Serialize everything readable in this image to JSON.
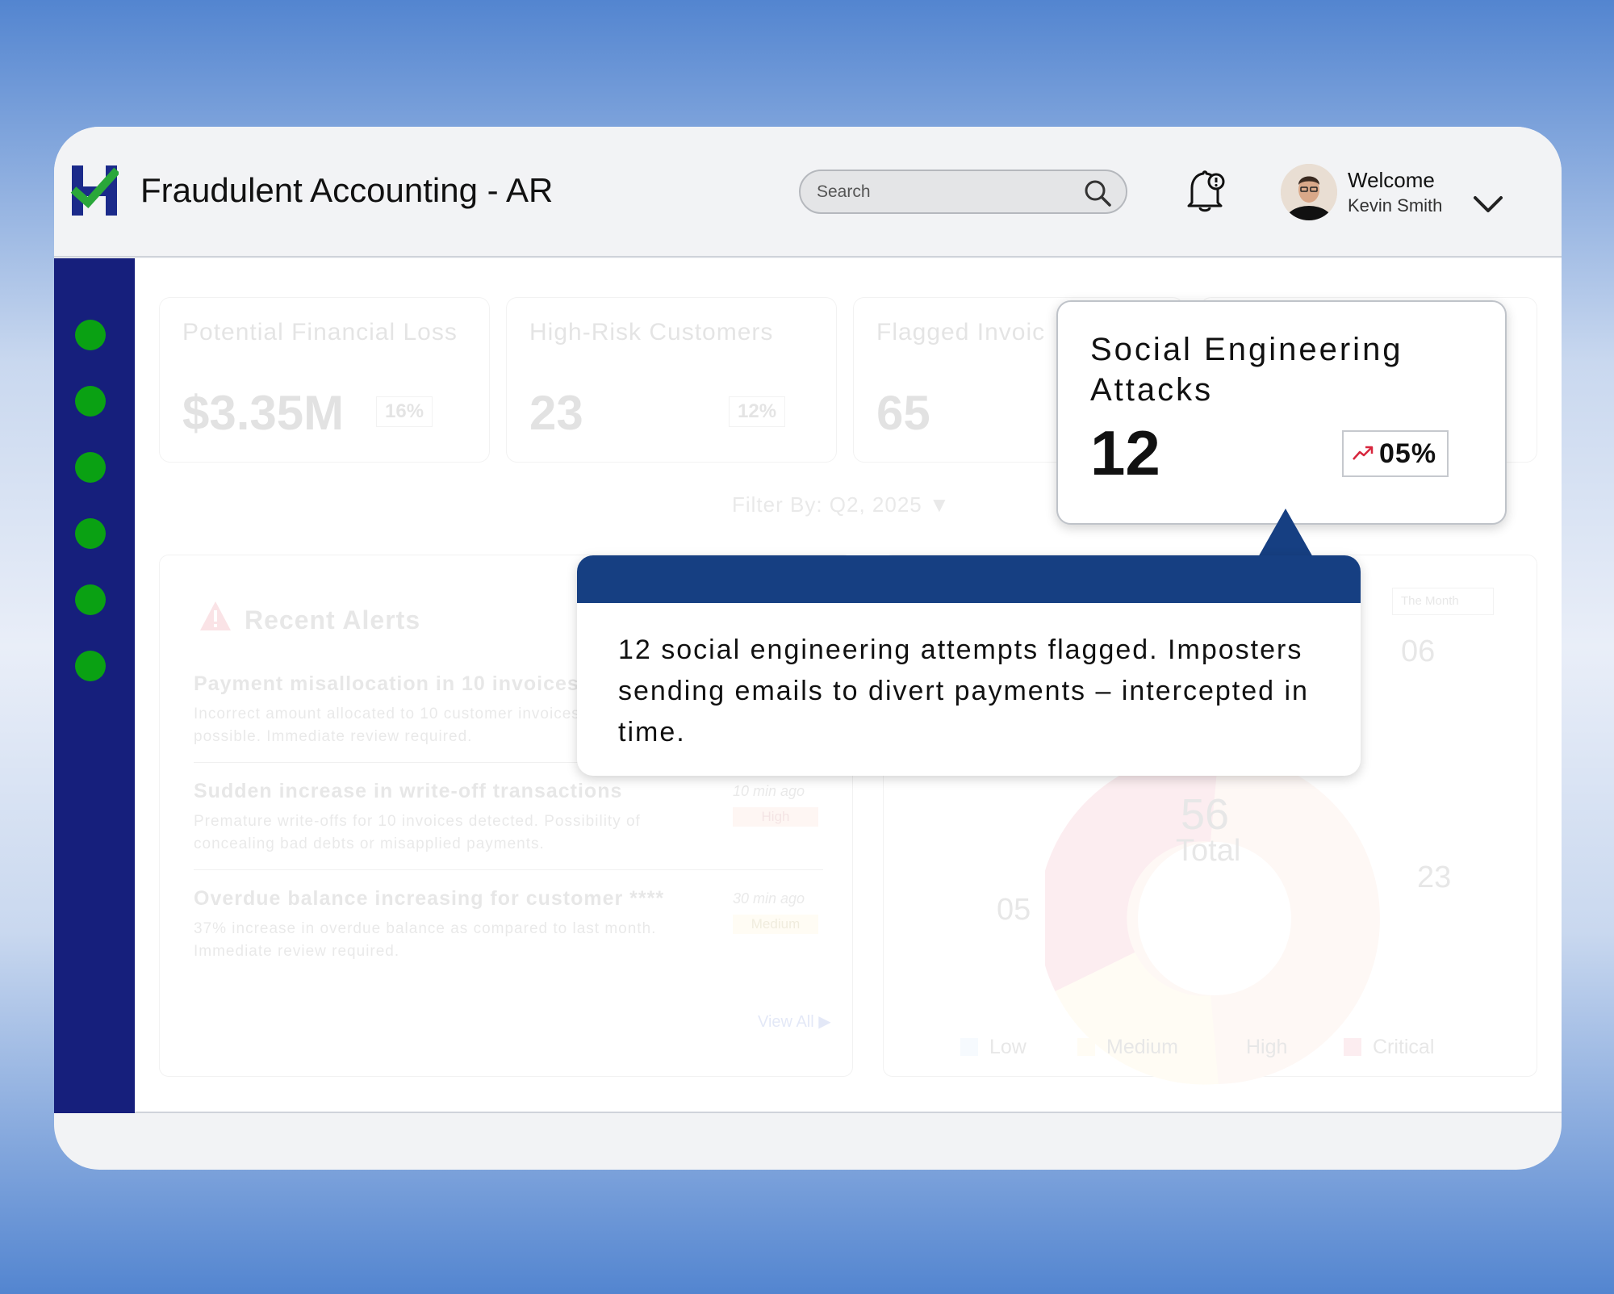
{
  "app": {
    "title": "Fraudulent Accounting - AR"
  },
  "search": {
    "placeholder": "Search"
  },
  "user": {
    "greeting": "Welcome",
    "name": "Kevin Smith"
  },
  "sidebar": {
    "items": [
      "nav-1",
      "nav-2",
      "nav-3",
      "nav-4",
      "nav-5",
      "nav-6"
    ]
  },
  "kpis": [
    {
      "title": "Potential Financial Loss",
      "value": "$3.35M",
      "delta": "16%",
      "trend": "down"
    },
    {
      "title": "High-Risk Customers",
      "value": "23",
      "delta": "12%",
      "trend": "up"
    },
    {
      "title": "Flagged Invoic",
      "value": "65"
    }
  ],
  "filter": {
    "label": "Filter By: Q2, 2025 ▼"
  },
  "alerts": {
    "title": "Recent Alerts",
    "items": [
      {
        "title": "Payment misallocation in 10 invoices",
        "desc": "Incorrect amount allocated to 10 customer invoices attempt possible. Immediate review required."
      },
      {
        "title": "Sudden increase in write-off transactions",
        "desc": "Premature write-offs for 10 invoices detected. Possibility of concealing bad debts or misapplied payments.",
        "time": "10 min ago",
        "badge": "High"
      },
      {
        "title": "Overdue balance increasing for customer ****",
        "desc": "37% increase in overdue balance as compared to last month. Immediate review required.",
        "time": "30 min ago",
        "badge": "Medium"
      }
    ],
    "view_all": "View All ▶"
  },
  "risk_chart": {
    "period": "The Month",
    "total_value": "56",
    "total_label": "Total",
    "labels": [
      "06",
      "23",
      "05"
    ],
    "legend": [
      "Low",
      "Medium",
      "High",
      "Critical"
    ],
    "colors": {
      "low": "#b9d6f7",
      "medium": "#fbe9a8",
      "high": "#f7c9b3",
      "critical": "#e9758a"
    }
  },
  "popup": {
    "title": "Social Engineering Attacks",
    "value": "12",
    "delta": "05%",
    "trend": "up"
  },
  "tooltip": {
    "text": "12 social engineering attempts flagged. Imposters sending emails to divert payments – intercepted in time."
  },
  "colors": {
    "sidebar": "#161f7c",
    "nav_dot": "#0aa113",
    "tooltip_header": "#163f82",
    "trend_up": "#d7263d"
  },
  "icons": {
    "search": "search-icon",
    "bell": "bell-icon",
    "chevron": "chevron-down-icon",
    "warning": "warning-icon",
    "trend": "trend-up-icon"
  }
}
